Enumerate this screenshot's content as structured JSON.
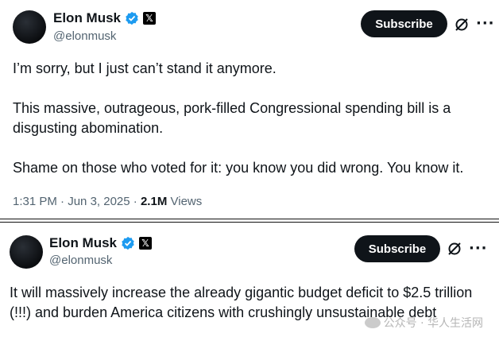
{
  "post1": {
    "author_name": "Elon Musk",
    "handle": "@elonmusk",
    "subscribe_label": "Subscribe",
    "text": "I’m sorry, but I just can’t stand it anymore.\n\nThis massive, outrageous, pork-filled Congressional spending bill is a disgusting abomination.\n\nShame on those who voted for it: you know you did wrong. You know it.",
    "time": "1:31 PM",
    "date": "Jun 3, 2025",
    "views_count": "2.1M",
    "views_label": "Views",
    "separator": "·"
  },
  "post2": {
    "author_name": "Elon Musk",
    "handle": "@elonmusk",
    "subscribe_label": "Subscribe",
    "text": "It will massively increase the already gigantic budget deficit to $2.5 trillion (!!!) and burden America citizens with crushingly unsustainable debt"
  },
  "watermark": {
    "text": "公众号 · 华人生活网"
  },
  "icons": {
    "verified": "verified-badge-icon",
    "x": "x-logo-icon",
    "grok": "grok-icon",
    "more": "more-icon"
  },
  "colors": {
    "verified_blue": "#1d9bf0",
    "button_bg": "#0f1419",
    "secondary_text": "#536471"
  }
}
